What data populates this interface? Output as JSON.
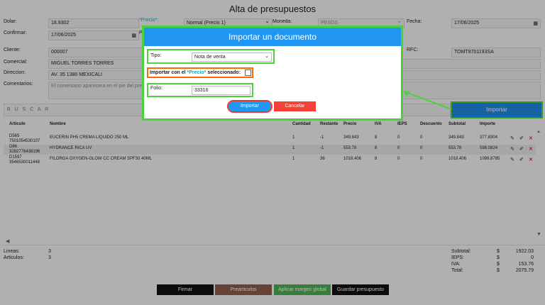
{
  "page": {
    "title": "Alta de presupuestos"
  },
  "form": {
    "dolar_label": "Dolar:",
    "dolar_value": "18.9302",
    "precio_label": "*Precio*:",
    "precio_value": "Normal (Precio 1)",
    "moneda_label": "Moneda:",
    "moneda_value": "PESOS",
    "fecha_label": "Fecha:",
    "fecha_value": "17/06/2025",
    "confirmar_label": "Confirmar:",
    "confirmar_value": "17/06/2025",
    "pr_label": "Pr",
    "cliente_label": "Cliente:",
    "cliente_value": "000007",
    "rfc_label": "RFC:",
    "rfc_value": "TOMT8701193SA",
    "comercial_label": "Comercial:",
    "comercial_value": "MIGUEL TORRES TORRES",
    "direccion_label": "Direccion:",
    "direccion_value": "AV. 35 1380 MEXICALI",
    "comentarios_label": "Comentarios:",
    "comentarios_placeholder": "El comentario aparecera en el pie del presu"
  },
  "search": {
    "placeholder": "B U S C A R",
    "import_button": "Importar"
  },
  "table": {
    "headers": {
      "articulo": "Articulo",
      "nombre": "Nombre",
      "cantidad": "Cantidad",
      "restante": "Restante",
      "precio": "Precio",
      "iva": "IVA",
      "ieps": "IEPS",
      "descuento": "Descuento",
      "subtotal": "Subtotal",
      "importe": "Importe"
    },
    "rows": [
      {
        "code": "D565",
        "barcode": "7501054530107",
        "nombre": "EUCERIN PH5 CREMA LIQUIDO 250 ML",
        "cantidad": "1",
        "restante": "-1",
        "precio": "349.843",
        "iva": "8",
        "ieps": "0",
        "descuento": "0",
        "subtotal": "349.843",
        "importe": "377.8304"
      },
      {
        "code": "D86",
        "barcode": "3282776438196",
        "nombre": "HYDRANCE RICA UV",
        "cantidad": "1",
        "restante": "-1",
        "precio": "553.78",
        "iva": "8",
        "ieps": "0",
        "descuento": "0",
        "subtotal": "553.78",
        "importe": "598.0824"
      },
      {
        "code": "D1597",
        "barcode": "3546530011448",
        "nombre": "FILORGA OXYGEN-GLOW CC CREAM SPF30 40ML",
        "cantidad": "1",
        "restante": "36",
        "precio": "1018.406",
        "iva": "8",
        "ieps": "0",
        "descuento": "0",
        "subtotal": "1018.406",
        "importe": "1099.8785"
      }
    ]
  },
  "summary": {
    "lineas_label": "Lineas:",
    "lineas_value": "3",
    "articulos_label": "Articulos:",
    "articulos_value": "3",
    "subtotal_label": "Subtotal:",
    "subtotal_value": "1922.03",
    "ieps_label": "IEPS:",
    "ieps_value": "0",
    "iva_label": "IVA:",
    "iva_value": "153.76",
    "total_label": "Total:",
    "total_value": "2075.79",
    "currency": "$"
  },
  "footer": {
    "firmar": "Firmar",
    "prearticulos": "Prearticulos",
    "aplicar": "Aplicar margen global",
    "guardar": "Guardar presupuesto"
  },
  "modal": {
    "title": "Importar un documento",
    "tipo_label": "Tipo:",
    "tipo_value": "Nota de venta",
    "importar_precio_prefix": "Importar con el",
    "importar_precio_highlight": "*Precio*",
    "importar_precio_suffix": "seleccionado:",
    "folio_label": "Folio:",
    "folio_value": "33316",
    "importar_button": "Importar",
    "cancelar_button": "Cancelar"
  },
  "colors": {
    "accent_blue": "#2196f3",
    "annotation_green": "#4cd13e",
    "annotation_orange": "#ff6a00",
    "cancel_red": "#f44336",
    "precio_teal": "#1aa3b8"
  },
  "icons": [
    "edit-icon",
    "pencil-icon",
    "delete-icon",
    "calendar-icon",
    "chevron-down-icon"
  ]
}
